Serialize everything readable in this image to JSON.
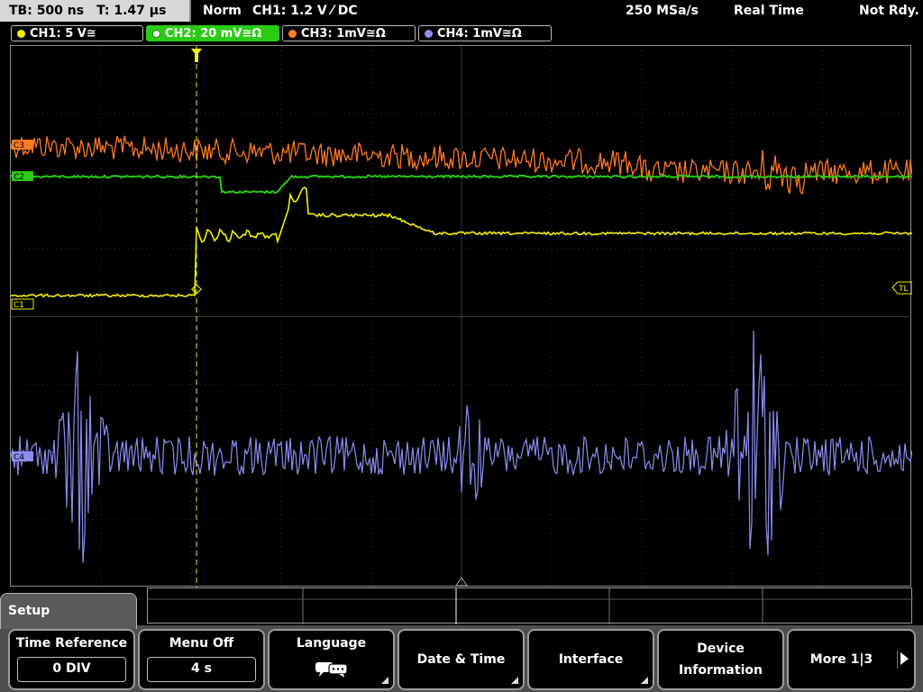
{
  "status": {
    "tb": "TB: 500 ns",
    "t": "T: 1.47 µs",
    "mode": "Norm",
    "trigger": "CH1: 1.2 V ⁄ DC",
    "samplerate": "250 MSa/s",
    "acq": "Real Time",
    "ready": "Not Rdy."
  },
  "channels": [
    {
      "label": "CH1: 5 V≅",
      "color": "#f5f000"
    },
    {
      "label": "CH2: 20 mV≅Ω",
      "color": "#29cc14"
    },
    {
      "label": "CH3: 1mV≅Ω",
      "color": "#ff7a1e"
    },
    {
      "label": "CH4: 1mV≅Ω",
      "color": "#8c8cf0"
    }
  ],
  "screen": {
    "markers": {
      "c1": "C1",
      "c2": "C2",
      "c3": "C3",
      "c4": "C4",
      "tl": "TL"
    }
  },
  "menu": {
    "title": "Setup",
    "time_reference": {
      "label": "Time Reference",
      "value": "0 DIV"
    },
    "menu_off": {
      "label": "Menu Off",
      "value": "4 s"
    },
    "language": {
      "label": "Language"
    },
    "date_time": {
      "label": "Date & Time"
    },
    "interface": {
      "label": "Interface"
    },
    "device_info": {
      "line1": "Device",
      "line2": "Information"
    },
    "more": {
      "label": "More 1|3"
    }
  }
}
